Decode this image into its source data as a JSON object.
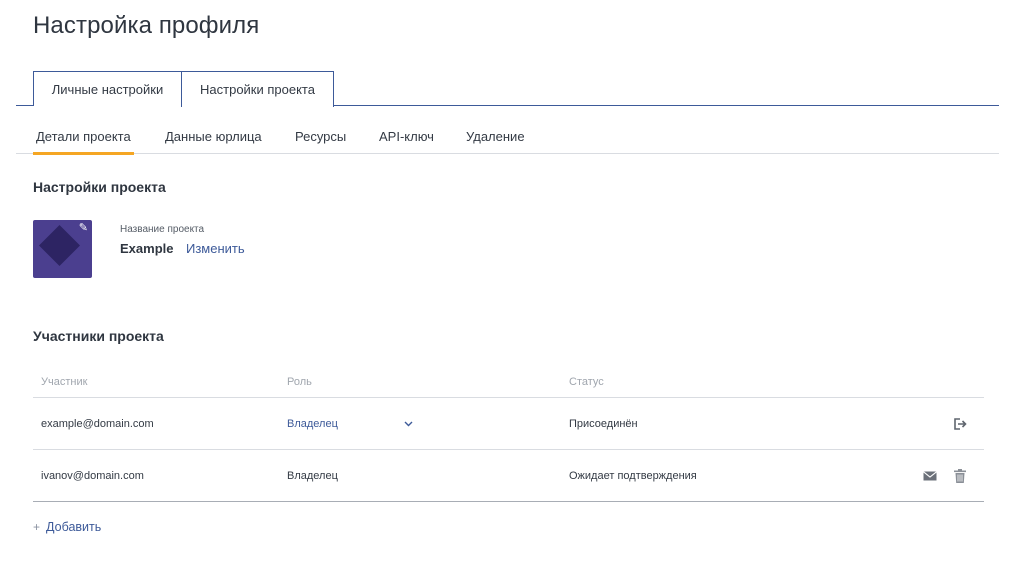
{
  "page": {
    "title": "Настройка профиля"
  },
  "main_tabs": [
    {
      "label": "Личные настройки",
      "active": false
    },
    {
      "label": "Настройки проекта",
      "active": true
    }
  ],
  "sub_tabs": [
    {
      "label": "Детали проекта",
      "active": true
    },
    {
      "label": "Данные юрлица",
      "active": false
    },
    {
      "label": "Ресурсы",
      "active": false
    },
    {
      "label": "API-ключ",
      "active": false
    },
    {
      "label": "Удаление",
      "active": false
    }
  ],
  "project_settings": {
    "title": "Настройки проекта",
    "name_label": "Название проекта",
    "name_value": "Example",
    "edit_label": "Изменить",
    "logo_icon": "pencil-icon"
  },
  "members": {
    "title": "Участники проекта",
    "columns": [
      "Участник",
      "Роль",
      "Статус"
    ],
    "rows": [
      {
        "member": "example@domain.com",
        "role": "Владелец",
        "role_editable": true,
        "status": "Присоединён",
        "actions": [
          "leave-icon"
        ]
      },
      {
        "member": "ivanov@domain.com",
        "role": "Владелец",
        "role_editable": false,
        "status": "Ожидает подтверждения",
        "actions": [
          "mail-icon",
          "trash-icon"
        ]
      }
    ],
    "add_label": "Добавить"
  },
  "colors": {
    "accent": "#3d5a99",
    "tab_underline": "#f5a623",
    "logo_bg": "#4b3f8f"
  }
}
